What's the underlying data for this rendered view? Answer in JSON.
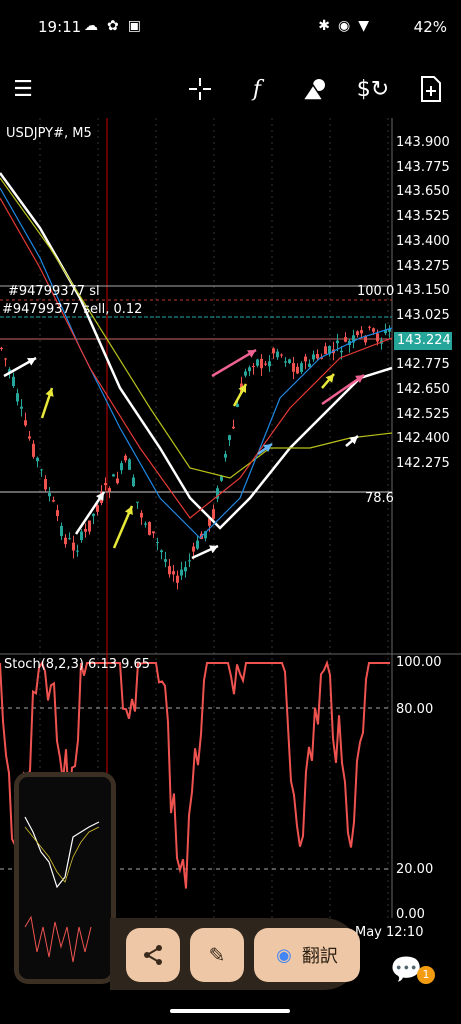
{
  "status": {
    "time": "19:11",
    "battery": "42%"
  },
  "toolbar": {
    "icons": [
      "menu-icon",
      "crosshair-icon",
      "function-icon",
      "objects-icon",
      "trade-icon",
      "new-order-icon"
    ]
  },
  "chart": {
    "symbol_label": "USDJPY#, M5",
    "order_sl_label": "#94799377 sl",
    "order_sell_label": "#94799377 sell, 0.12",
    "fib_100": "100.0",
    "fib_786": "78.6",
    "current_price": "143.224",
    "price_axis": [
      "143.900",
      "143.775",
      "143.650",
      "143.525",
      "143.400",
      "143.275",
      "143.150",
      "143.025",
      "142.900",
      "142.775",
      "142.650",
      "142.525",
      "142.400",
      "142.275"
    ],
    "stoch_label": "Stoch(8,2,3) 6.13 9.65",
    "stoch_axis": [
      "100.00",
      "80.00",
      "20.00",
      "0.00"
    ],
    "time_label": "May 12:10"
  },
  "actions": {
    "translate_label": "翻訳"
  },
  "chat_badge": "1",
  "colors": {
    "up": "#26a69a",
    "down": "#ef5350",
    "price_tag": "#26a69a"
  }
}
